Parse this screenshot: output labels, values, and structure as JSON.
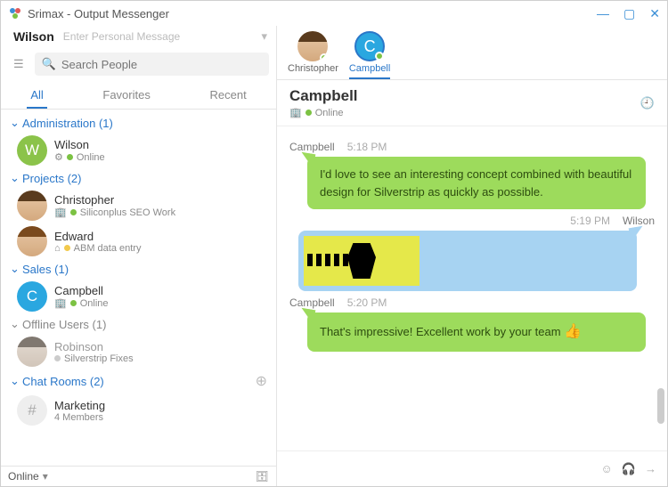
{
  "window": {
    "title": "Srimax - Output Messenger"
  },
  "profile": {
    "username": "Wilson",
    "personal_msg_placeholder": "Enter Personal Message"
  },
  "search": {
    "placeholder": "Search People"
  },
  "tabs": {
    "all": "All",
    "favorites": "Favorites",
    "recent": "Recent"
  },
  "groups": {
    "admin": {
      "label": "Administration (1)"
    },
    "projects": {
      "label": "Projects (2)"
    },
    "sales": {
      "label": "Sales (1)"
    },
    "offline": {
      "label": "Offline Users (1)"
    },
    "rooms": {
      "label": "Chat Rooms (2)"
    }
  },
  "contacts": {
    "wilson": {
      "name": "Wilson",
      "status": "Online"
    },
    "christopher": {
      "name": "Christopher",
      "status": "Siliconplus SEO Work"
    },
    "edward": {
      "name": "Edward",
      "status": "ABM data entry"
    },
    "campbell": {
      "name": "Campbell",
      "status": "Online"
    },
    "robinson": {
      "name": "Robinson",
      "status": "Silverstrip Fixes"
    },
    "marketing": {
      "name": "Marketing",
      "status": "4 Members"
    }
  },
  "statusbar": {
    "text": "Online"
  },
  "chat_tabs": {
    "christopher": "Christopher",
    "campbell": "Campbell"
  },
  "chat_header": {
    "name": "Campbell",
    "status": "Online"
  },
  "messages": {
    "m1": {
      "sender": "Campbell",
      "time": "5:18 PM",
      "text": "I'd love to see an interesting concept combined with beautiful design for Silverstrip as quickly as possible."
    },
    "m2": {
      "sender": "Wilson",
      "time": "5:19 PM"
    },
    "m3": {
      "sender": "Campbell",
      "time": "5:20 PM",
      "text": "That's impressive! Excellent work by your team "
    }
  }
}
